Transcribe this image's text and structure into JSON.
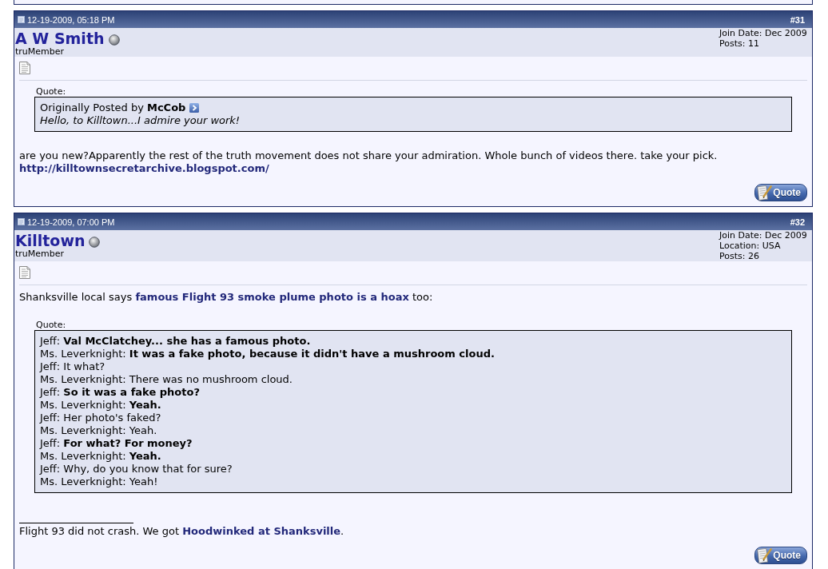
{
  "posts": [
    {
      "date": "12-19-2009, 05:18 PM",
      "number": "#31",
      "username": "A W Smith",
      "online": false,
      "rank": "truMember",
      "user_info": [
        "Join Date: Dec 2009",
        "Posts: 11"
      ],
      "blocks": [
        {
          "kind": "quote",
          "label": "Quote:",
          "attribution": "Originally Posted by **McCob**",
          "message": "Hello, to Killtown...I admire your work!"
        },
        {
          "kind": "paragraph",
          "parts": [
            {
              "kind": "text",
              "text": "are you new?Apparently the rest of the truth movement does not share your admiration. Whole bunch of videos there. take your pick."
            },
            {
              "kind": "break"
            },
            {
              "kind": "link",
              "text": "http://killtownsecretarchive.blogspot.com/"
            }
          ]
        }
      ],
      "button": "Quote"
    },
    {
      "date": "12-19-2009, 07:00 PM",
      "number": "#32",
      "username": "Killtown",
      "online": false,
      "rank": "truMember",
      "user_info": [
        "Join Date: Dec 2009",
        "Location: USA",
        "Posts: 26"
      ],
      "blocks": [
        {
          "kind": "paragraph",
          "parts": [
            {
              "kind": "text",
              "text": "Shanksville local says "
            },
            {
              "kind": "link",
              "text": "famous Flight 93 smoke plume photo is a hoax"
            },
            {
              "kind": "text",
              "text": " too:"
            }
          ]
        },
        {
          "kind": "quote",
          "label": "Quote:",
          "lines": [
            "Jeff: **Val McClatchey... she has a famous photo.**",
            "Ms. Leverknight: **It was a fake photo, because it didn't have a mushroom cloud.**",
            "Jeff: It what?",
            "Ms. Leverknight: There was no mushroom cloud.",
            "Jeff: **So it was a fake photo?**",
            "Ms. Leverknight: **Yeah.**",
            "Jeff: Her photo's faked?",
            "Ms. Leverknight: Yeah.",
            "Jeff: **For what? For money?**",
            "Ms. Leverknight: **Yeah.**",
            "Jeff: Why, do you know that for sure?",
            "Ms. Leverknight: Yeah!"
          ]
        }
      ],
      "signature": {
        "parts": [
          {
            "kind": "text",
            "text": "Flight 93 did not crash. We got "
          },
          {
            "kind": "link",
            "text": "Hoodwinked at Shanksville"
          },
          {
            "kind": "text",
            "text": "."
          }
        ]
      },
      "button": "Quote"
    }
  ]
}
